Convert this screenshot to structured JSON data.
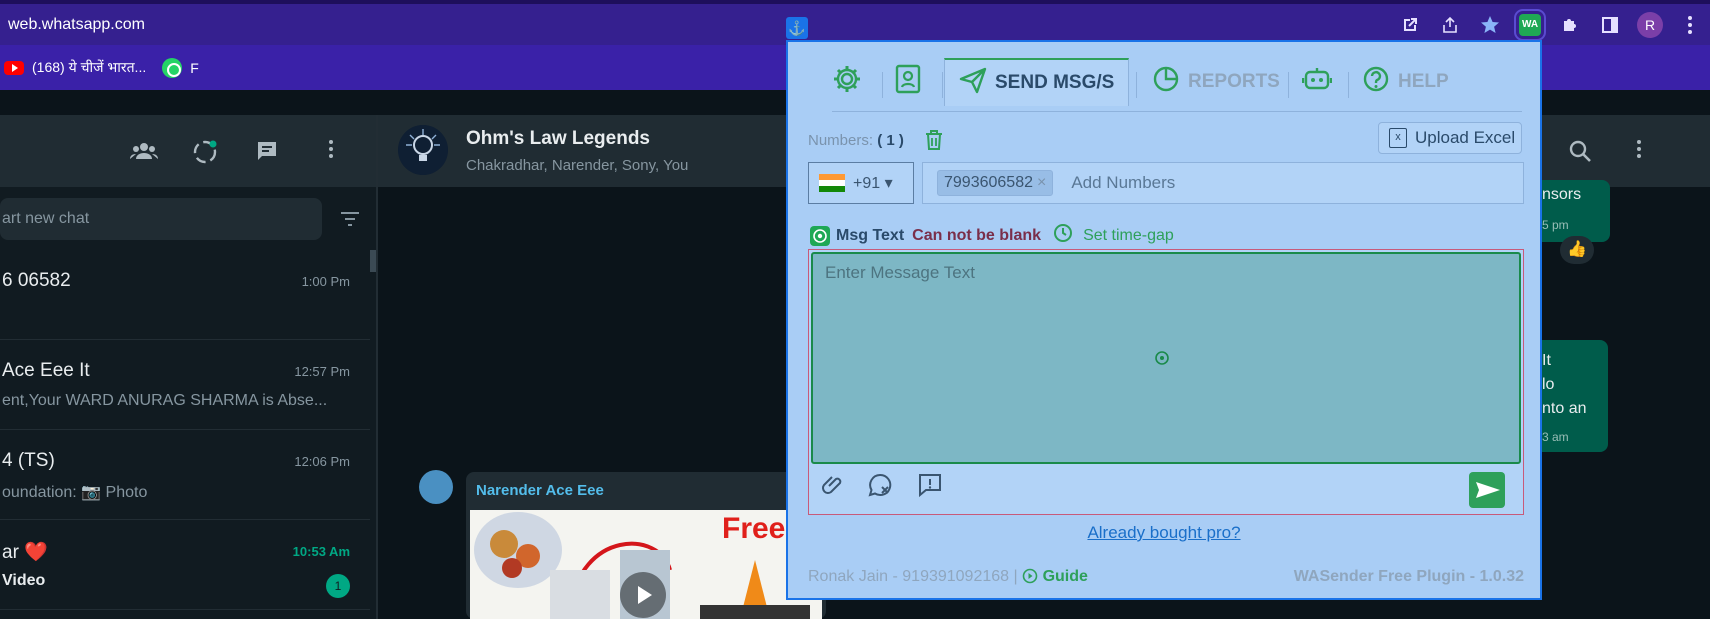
{
  "browser": {
    "url": "web.whatsapp.com",
    "extension_badge": "WA",
    "profile_initial": "R",
    "bookmarks": [
      {
        "label": "(168) ये चीजें भारत..."
      },
      {
        "label": "F"
      }
    ]
  },
  "whatsapp": {
    "search_placeholder": "art new chat",
    "chats": [
      {
        "name": "6 06582",
        "time": "1:00 Pm",
        "subtitle": ""
      },
      {
        "name": "Ace Eee It",
        "time": "12:57 Pm",
        "subtitle": "ent,Your WARD ANURAG SHARMA is Abse..."
      },
      {
        "name": "4 (TS)",
        "time": "12:06 Pm",
        "subtitle": "oundation: 📷 Photo"
      },
      {
        "name": "ar ❤️",
        "time": "10:53 Am",
        "subtitle": "Video",
        "unread": "1"
      }
    ],
    "group": {
      "name": "Ohm's Law Legends",
      "members": "Chakradhar, Narender, Sony, You"
    },
    "message": {
      "sender": "Narender Ace Eee",
      "image_text": "Free"
    },
    "right_bubbles": {
      "top_line": "nsors",
      "top_time": "5 pm",
      "bottom_lines": [
        "It",
        "lo",
        "nto an"
      ],
      "bottom_time": "3 am"
    }
  },
  "extension": {
    "tabs": [
      {
        "label": "",
        "icon": "gear-icon"
      },
      {
        "label": "",
        "icon": "contact-card-icon"
      },
      {
        "label": "SEND MSG/S",
        "icon": "send-icon",
        "active": true
      },
      {
        "label": "REPORTS",
        "icon": "pie-chart-icon"
      },
      {
        "label": "",
        "icon": "robot-icon"
      },
      {
        "label": "HELP",
        "icon": "question-icon"
      }
    ],
    "numbers_label": "Numbers:",
    "numbers_count": "( 1 )",
    "upload_label": "Upload Excel",
    "country_code": "+91 ▾",
    "number_chip": "7993606582",
    "numbers_placeholder": "Add Numbers",
    "msg_text_label": "Msg Text",
    "msg_error": "Can not be blank",
    "time_gap_label": "Set time-gap",
    "msg_placeholder": "Enter Message Text",
    "already_bought": "Already bought pro?",
    "footer_left": "Ronak Jain - 919391092168 |",
    "guide_label": "Guide",
    "footer_right": "WASender Free Plugin - 1.0.32"
  },
  "colors": {
    "ext_bg": "#a9cdf5",
    "ext_accent": "#2ea05a",
    "wa_bg": "#111b21",
    "chrome_bar": "#35208f"
  }
}
